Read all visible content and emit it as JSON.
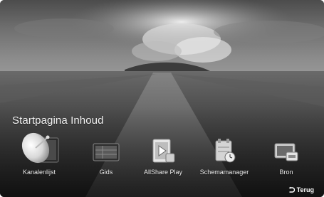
{
  "menu": {
    "title": "Startpagina Inhoud"
  },
  "apps": [
    {
      "label": "Kanalenlijst",
      "icon": "satellite-dish-icon",
      "selected": true
    },
    {
      "label": "Gids",
      "icon": "tv-guide-icon",
      "selected": false
    },
    {
      "label": "AllShare Play",
      "icon": "media-play-icon",
      "selected": false
    },
    {
      "label": "Schemamanager",
      "icon": "schedule-manager-icon",
      "selected": false
    },
    {
      "label": "Bron",
      "icon": "input-source-icon",
      "selected": false
    }
  ],
  "footer": {
    "back_label": "Terug",
    "back_icon": "return-arrow-icon"
  },
  "colors": {
    "text": "#f2f2f2",
    "background": "#3a3a3a"
  }
}
